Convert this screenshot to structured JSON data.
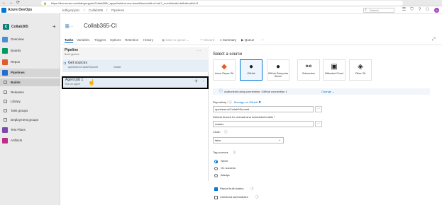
{
  "browser": {
    "back": "←",
    "forward": "→",
    "reload": "⟳",
    "url": "https://dev.azure.com/kdhgxzpydo/Collab365/_apps/hub/ms.vss-ciworkflow.build-ci-hub?_a=edit-build-definition&id=3",
    "lock": "🔒"
  },
  "header": {
    "brand": "Azure DevOps",
    "crumbs": [
      "kdhgxzpydo",
      "/",
      "Collab365",
      "/",
      "Pipelines"
    ],
    "search": "Search",
    "avatar": "A",
    "icons": {
      "list": "☰",
      "bag": "⛉",
      "help": "?",
      "person": "⚇"
    }
  },
  "sidebar": {
    "project": {
      "initial": "C",
      "name": "Collab365",
      "add": "+"
    },
    "items": [
      {
        "label": "Overview",
        "color": "#4a8fd6"
      },
      {
        "label": "Boards",
        "color": "#009a5e"
      },
      {
        "label": "Repos",
        "color": "#e05d2a"
      },
      {
        "label": "Pipelines",
        "color": "#1f6ed0",
        "active": true
      },
      {
        "label": "Builds",
        "sub": true,
        "active": true
      },
      {
        "label": "Releases",
        "sub": true
      },
      {
        "label": "Library",
        "sub": true
      },
      {
        "label": "Task groups",
        "sub": true
      },
      {
        "label": "Deployment groups",
        "sub": true
      },
      {
        "label": "Test Plans",
        "color": "#7c4ba8"
      },
      {
        "label": "Artifacts",
        "color": "#bd2f84"
      }
    ]
  },
  "editor": {
    "pipe_icon": "⛓",
    "ellipsis": "···",
    "title": "Collab365-CI",
    "tabs": [
      "Tasks",
      "Variables",
      "Triggers",
      "Options",
      "Retention",
      "History"
    ],
    "tools": [
      "Save & queue",
      "Discard",
      "Summary",
      "Queue",
      "···"
    ],
    "expand": "⤢"
  },
  "pipeline": {
    "title": "Pipeline",
    "subtitle": "Build pipeline",
    "dots": "···",
    "get_sources": "Get sources",
    "repo": "apexlearnn/Collab9Summit",
    "branch": "master",
    "agent_job_title": "Agent job 1",
    "agent_job_sub": "Run on agent",
    "add": "+",
    "menu": "⋮",
    "cursor": "☝"
  },
  "source": {
    "title": "Select a source",
    "options": [
      {
        "label": "Azure Repos Git",
        "icon": "◆"
      },
      {
        "label": "GitHub",
        "icon": "●",
        "selected": true
      },
      {
        "label": "GitHub Enterprise Server",
        "icon": "●"
      },
      {
        "label": "Subversion",
        "icon": "⚯"
      },
      {
        "label": "Bitbucket Cloud",
        "icon": "▣"
      },
      {
        "label": "Other Git",
        "icon": "◈"
      }
    ],
    "auth_text": "Authorized using connection: GitHub connection 1",
    "auth_change": "Change ⌄",
    "repository_label": "Repository * ⓘ",
    "manage": "Manage on GitHub ⧉",
    "repository_value": "apexlearnn/Collab9Summit",
    "branch_label": "Default branch for manual and scheduled builds *",
    "branch_value": "master",
    "more": "···",
    "clean_label": "Clean",
    "clean_value": "false",
    "clean_chev": "⌄",
    "tag_label": "Tag sources",
    "tag_options": [
      "Never",
      "On success",
      "Always"
    ],
    "tag_selected": 0,
    "report_label": "Report build status",
    "report_checked": true,
    "checkout_label": "Checkout submodules",
    "checkout_checked": false,
    "info": "ⓘ"
  }
}
